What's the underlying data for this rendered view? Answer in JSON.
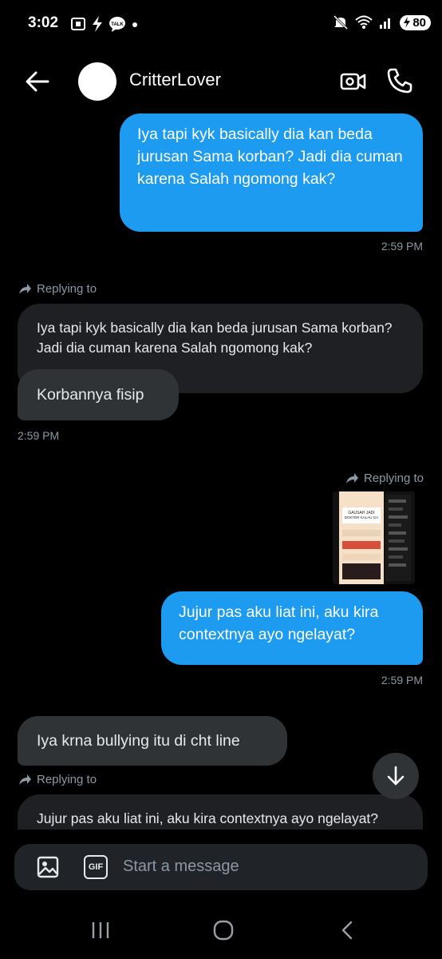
{
  "status": {
    "time": "3:02",
    "battery": "80"
  },
  "header": {
    "username": "CritterLover"
  },
  "messages": {
    "m1": {
      "text": "Iya tapi kyk basically dia kan beda jurusan Sama korban? Jadi dia cuman karena Salah ngomong kak?",
      "time": "2:59 PM"
    },
    "m2": {
      "replying_label": "Replying to",
      "quote": "Iya tapi kyk basically dia kan beda jurusan Sama korban? Jadi dia cuman karena Salah ngomong  kak?",
      "text": "Korbannya fisip",
      "time": "2:59 PM"
    },
    "m3": {
      "replying_label": "Replying to",
      "text": "Jujur pas aku liat ini, aku kira contextnya ayo ngelayat?",
      "time": "2:59 PM"
    },
    "m4": {
      "text": "Iya krna bullying itu di cht line"
    },
    "m5": {
      "replying_label": "Replying to",
      "quote": "Jujur pas aku liat ini, aku kira contextnya ayo ngelayat?"
    }
  },
  "thumbnail": {
    "headline": "GAUSAH JADI DOKTER KALAU GA PUNYA HATI"
  },
  "composer": {
    "placeholder": "Start a message",
    "gif_label": "GIF"
  },
  "colors": {
    "accent": "#1d9bf0",
    "bubble_in": "#2f3336",
    "mic": "#7856ff"
  }
}
